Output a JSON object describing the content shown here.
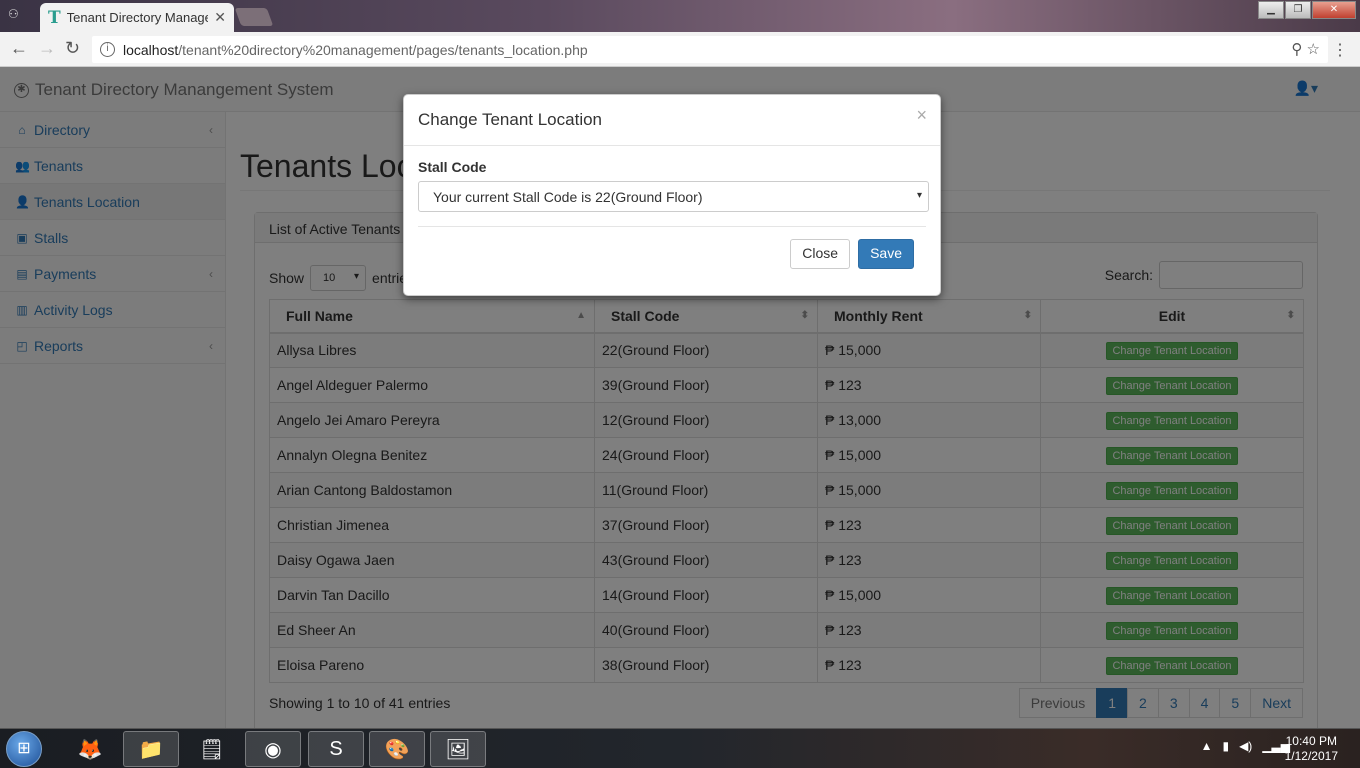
{
  "browser": {
    "tab_title": "Tenant Directory Manage",
    "tab_favicon": "T",
    "url_host": "localhost",
    "url_path": "/tenant%20directory%20management/pages/tenants_location.php"
  },
  "app": {
    "brand": "Tenant Directory Manangement System"
  },
  "sidebar": {
    "items": [
      {
        "label": "Directory",
        "icon": "home-icon",
        "chevron": true
      },
      {
        "label": "Tenants",
        "icon": "users-icon",
        "chevron": false
      },
      {
        "label": "Tenants Location",
        "icon": "user-icon",
        "chevron": false
      },
      {
        "label": "Stalls",
        "icon": "stall-icon",
        "chevron": false
      },
      {
        "label": "Payments",
        "icon": "money-icon",
        "chevron": true
      },
      {
        "label": "Activity Logs",
        "icon": "book-icon",
        "chevron": false
      },
      {
        "label": "Reports",
        "icon": "report-icon",
        "chevron": true
      }
    ]
  },
  "page": {
    "title": "Tenants Location",
    "panel_heading": "List of Active Tenants",
    "show_label": "Show",
    "entries_value": "10",
    "entries_label": "entries",
    "search_label": "Search:",
    "columns": [
      "Full Name",
      "Stall Code",
      "Monthly Rent",
      "Edit"
    ],
    "rows": [
      [
        "Allysa Libres",
        "22(Ground Floor)",
        "₱ 15,000",
        "Change Tenant Location"
      ],
      [
        "Angel Aldeguer Palermo",
        "39(Ground Floor)",
        "₱ 123",
        "Change Tenant Location"
      ],
      [
        "Angelo Jei Amaro Pereyra",
        "12(Ground Floor)",
        "₱ 13,000",
        "Change Tenant Location"
      ],
      [
        "Annalyn Olegna Benitez",
        "24(Ground Floor)",
        "₱ 15,000",
        "Change Tenant Location"
      ],
      [
        "Arian Cantong Baldostamon",
        "11(Ground Floor)",
        "₱ 15,000",
        "Change Tenant Location"
      ],
      [
        "Christian Jimenea",
        "37(Ground Floor)",
        "₱ 123",
        "Change Tenant Location"
      ],
      [
        "Daisy Ogawa Jaen",
        "43(Ground Floor)",
        "₱ 123",
        "Change Tenant Location"
      ],
      [
        "Darvin Tan Dacillo",
        "14(Ground Floor)",
        "₱ 15,000",
        "Change Tenant Location"
      ],
      [
        "Ed Sheer An",
        "40(Ground Floor)",
        "₱ 123",
        "Change Tenant Location"
      ],
      [
        "Eloisa Pareno",
        "38(Ground Floor)",
        "₱ 123",
        "Change Tenant Location"
      ]
    ],
    "info": "Showing 1 to 10 of 41 entries",
    "pager": [
      "Previous",
      "1",
      "2",
      "3",
      "4",
      "5",
      "Next"
    ]
  },
  "modal": {
    "title": "Change Tenant Location",
    "close_x": "×",
    "field_label": "Stall Code",
    "select_value": "Your current Stall Code is 22(Ground Floor)",
    "close_button": "Close",
    "save_button": "Save"
  },
  "taskbar": {
    "time": "10:40 PM",
    "date": "1/12/2017"
  }
}
